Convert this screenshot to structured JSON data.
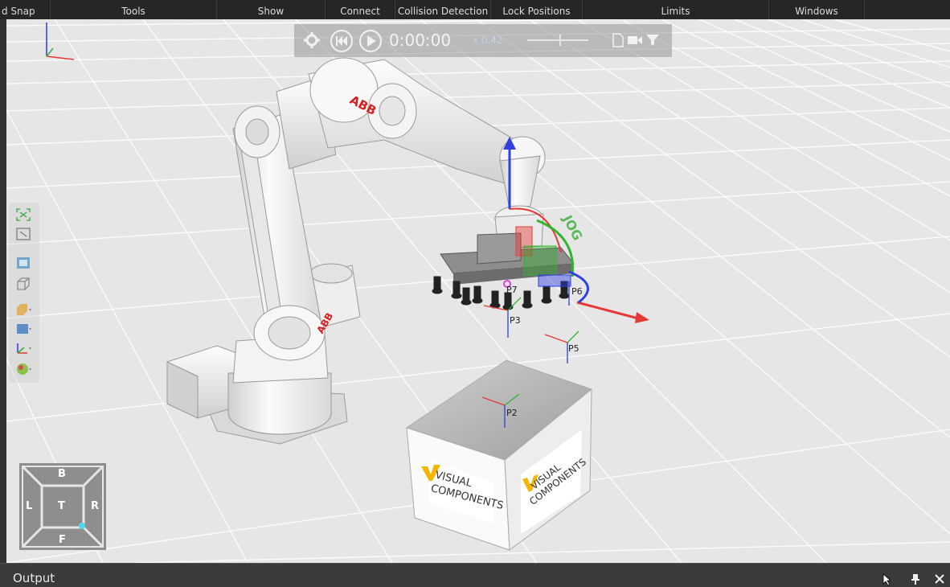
{
  "ribbon": {
    "groups": [
      {
        "label": "d Snap"
      },
      {
        "label": "Tools"
      },
      {
        "label": "Show"
      },
      {
        "label": "Connect"
      },
      {
        "label": "Collision Detection"
      },
      {
        "label": "Lock Positions"
      },
      {
        "label": "Limits"
      },
      {
        "label": "Windows"
      }
    ]
  },
  "playback": {
    "time": "0:00:00",
    "speed": "x 0.42",
    "icons": [
      "gear-icon",
      "rewind-icon",
      "play-icon",
      "speed-slider",
      "pdf-icon",
      "camera-icon",
      "filter-icon"
    ]
  },
  "scene": {
    "robot_brand": "ABB",
    "jog_label": "JOG",
    "frames": [
      {
        "label": "P2"
      },
      {
        "label": "P3"
      },
      {
        "label": "P5"
      },
      {
        "label": "P6"
      },
      {
        "label": "P7"
      }
    ],
    "box_logo_line1": "VISUAL",
    "box_logo_line2": "COMPONENTS"
  },
  "left_tools": [
    "fit-all-icon",
    "fit-selection-icon",
    "camera-view-icon",
    "wireframe-cube-icon",
    "render-mode-icon",
    "surface-mode-icon",
    "axis-display-icon",
    "material-sphere-icon"
  ],
  "navcube": {
    "top": "B",
    "left": "L",
    "center": "T",
    "right": "R",
    "bottom": "F"
  },
  "output": {
    "title": "Output"
  },
  "colors": {
    "background": "#e6e6e6",
    "grid": "#ffffff",
    "x_axis": "#e53935",
    "y_axis": "#2fb52f",
    "z_axis": "#2f3fe0",
    "brand_red": "#d32020"
  }
}
